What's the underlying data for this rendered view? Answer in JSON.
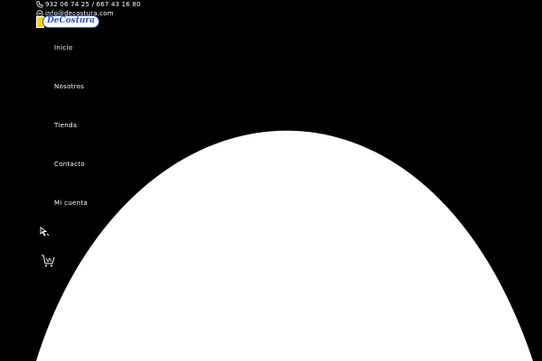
{
  "header": {
    "phone": "932 06 74 25 / 667 43 16 80",
    "email": "info@decostura.com"
  },
  "logo": {
    "text": "DeCostura"
  },
  "nav": {
    "items": [
      {
        "label": "Inicio"
      },
      {
        "label": "Nosotros"
      },
      {
        "label": "Tienda"
      },
      {
        "label": "Contacto"
      },
      {
        "label": "Mi cuenta"
      }
    ]
  },
  "icons": {
    "phone": "phone-icon",
    "mail": "mail-icon",
    "pointer": "cursor-icon",
    "cart": "cart-icon"
  },
  "colors": {
    "background": "#000000",
    "hero": "#ffffff",
    "logo_mark": "#f2d500",
    "logo_text": "#2a56c8"
  }
}
